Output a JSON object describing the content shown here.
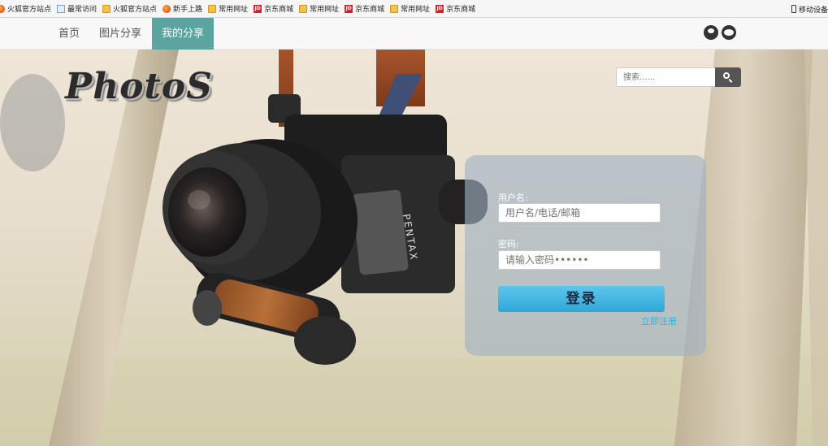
{
  "bookmarks": [
    {
      "icon": "firefox-icon",
      "label": "火狐官方站点"
    },
    {
      "icon": "page-icon",
      "label": "最常访问"
    },
    {
      "icon": "folder-icon",
      "label": "火狐官方站点"
    },
    {
      "icon": "firefox-icon",
      "label": "新手上路"
    },
    {
      "icon": "folder-icon",
      "label": "常用网址"
    },
    {
      "icon": "jd-icon",
      "label": "京东商城"
    },
    {
      "icon": "folder-icon",
      "label": "常用网址"
    },
    {
      "icon": "jd-icon",
      "label": "京东商城"
    },
    {
      "icon": "folder-icon",
      "label": "常用网址"
    },
    {
      "icon": "jd-icon",
      "label": "京东商城"
    }
  ],
  "bookmarks_right": {
    "icon": "mobile-icon",
    "label": "移动设备"
  },
  "jd_badge": "JD",
  "nav": {
    "items": [
      {
        "label": "首页",
        "active": false
      },
      {
        "label": "图片分享",
        "active": false
      },
      {
        "label": "我的分享",
        "active": true
      }
    ],
    "social_icons": [
      "qq-icon",
      "wechat-icon"
    ]
  },
  "logo": "PhotoS",
  "search": {
    "placeholder": "搜索......"
  },
  "login": {
    "username_label": "用户名:",
    "username_placeholder": "用户名/电话/邮箱",
    "password_label": "密码:",
    "password_placeholder": "请输入密码••••••",
    "submit_label": "登录",
    "register_link": "立即注册"
  },
  "colors": {
    "nav_active_bg": "#5ba4a0",
    "login_button": "#3ab3e1",
    "register_link": "#31b1e3",
    "search_button": "#555555"
  }
}
